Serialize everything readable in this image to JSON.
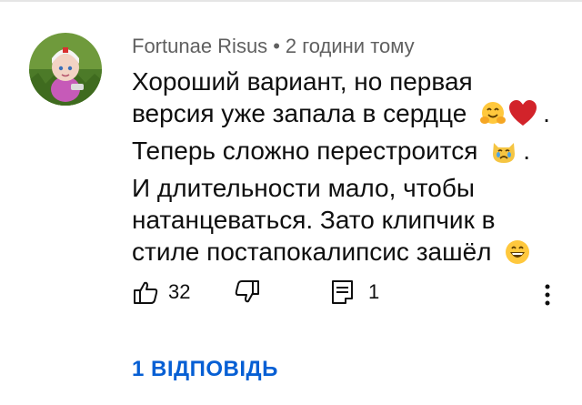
{
  "comment": {
    "author": "Fortunae Risus",
    "separator": "•",
    "timestamp": "2 години тому",
    "lines": [
      "Хороший вариант, но первая",
      "версия уже запала в сердце",
      "Теперь сложно перестроится",
      "И длительности мало, чтобы",
      "натанцеваться. Зато клипчик в",
      "стиле постапокалипсис зашёл"
    ],
    "line2_suffix": ".",
    "line3_suffix": ".",
    "emojis": [
      "hugging-face-emoji",
      "red-heart-emoji",
      "crying-cat-emoji",
      "grinning-face-emoji"
    ]
  },
  "actions": {
    "like_count": "32",
    "reply_count": "1",
    "icons": [
      "thumbs-up-icon",
      "thumbs-down-icon",
      "reply-icon",
      "more-vert-icon"
    ]
  },
  "replies_link": "1 ВІДПОВІДЬ",
  "colors": {
    "link": "#065fd4",
    "meta": "#606060",
    "text": "#0f0f0f"
  }
}
